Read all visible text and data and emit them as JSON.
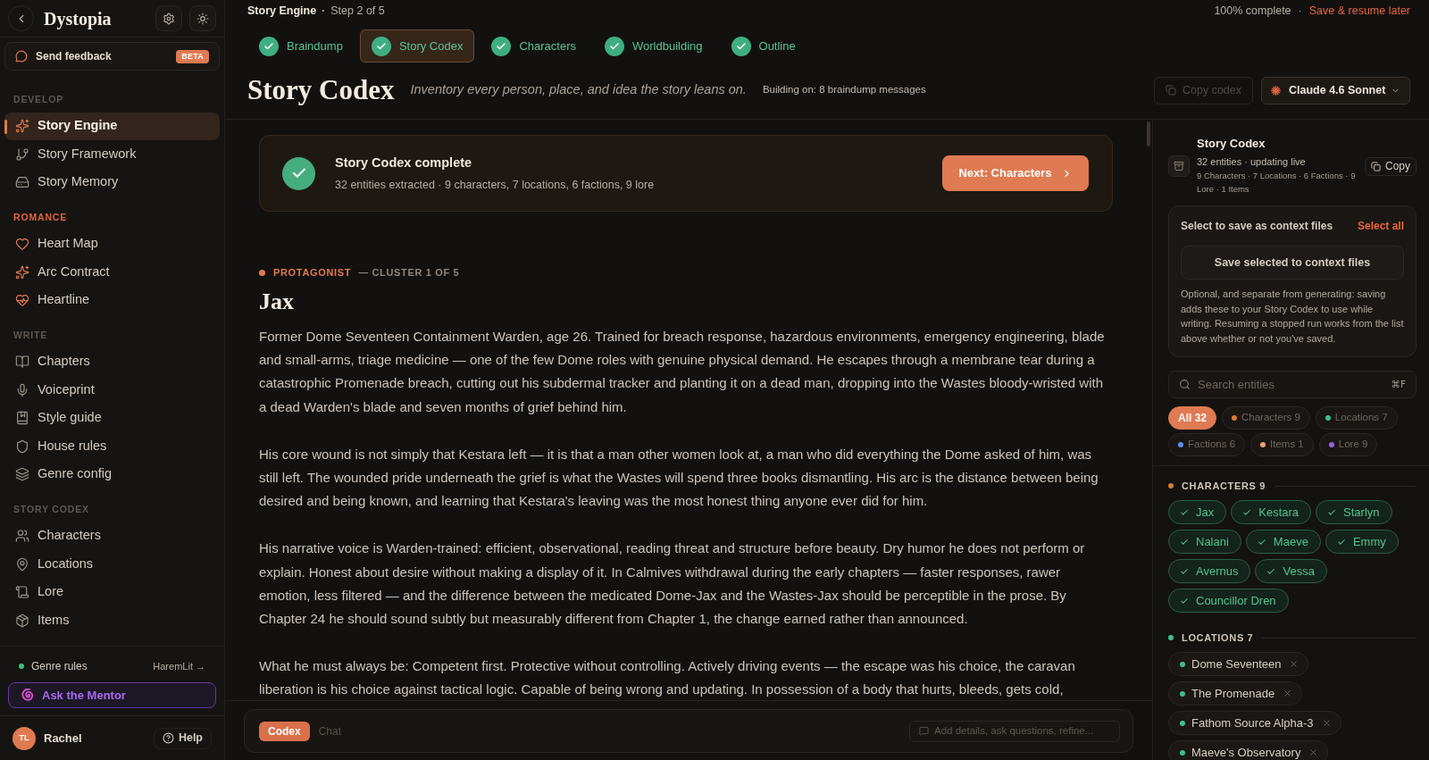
{
  "sidebar": {
    "brand": "Dystopia",
    "feedback": {
      "label": "Send feedback",
      "badge": "BETA"
    },
    "sections": [
      {
        "title": "DEVELOP",
        "highlighted": false,
        "items": [
          {
            "label": "Story Engine",
            "selected": true
          },
          {
            "label": "Story Framework",
            "selected": false
          },
          {
            "label": "Story Memory",
            "selected": false
          }
        ]
      },
      {
        "title": "ROMANCE",
        "highlighted": true,
        "items": [
          {
            "label": "Heart Map",
            "selected": false
          },
          {
            "label": "Arc Contract",
            "selected": false
          },
          {
            "label": "Heartline",
            "selected": false
          }
        ]
      },
      {
        "title": "WRITE",
        "highlighted": false,
        "items": [
          {
            "label": "Chapters",
            "selected": false
          },
          {
            "label": "Voiceprint",
            "selected": false
          },
          {
            "label": "Style guide",
            "selected": false
          },
          {
            "label": "House rules",
            "selected": false
          },
          {
            "label": "Genre config",
            "selected": false
          }
        ]
      },
      {
        "title": "STORY CODEX",
        "highlighted": false,
        "items": [
          {
            "label": "Characters",
            "selected": false
          },
          {
            "label": "Locations",
            "selected": false
          },
          {
            "label": "Lore",
            "selected": false
          },
          {
            "label": "Items",
            "selected": false
          }
        ]
      }
    ],
    "genre_rules": {
      "label": "Genre rules",
      "active": true,
      "value": "HaremLit →"
    },
    "mentor": "Ask the Mentor",
    "user": {
      "initials": "TL",
      "name": "Rachel"
    },
    "help": "Help"
  },
  "header": {
    "crumb": "Story Engine",
    "crumb_separator": "·",
    "step": "Step 2 of 5",
    "progress": "100% complete",
    "progress_separator": "·",
    "save": "Save & resume later"
  },
  "steps": [
    {
      "label": "Braindump",
      "done": true,
      "selected": false
    },
    {
      "label": "Story Codex",
      "done": true,
      "selected": true
    },
    {
      "label": "Characters",
      "done": true,
      "selected": false
    },
    {
      "label": "Worldbuilding",
      "done": true,
      "selected": false
    },
    {
      "label": "Outline",
      "done": true,
      "selected": false
    }
  ],
  "title_bar": {
    "title": "Story Codex",
    "subtitle": "Inventory every person, place, and idea the story leans on.",
    "context": "Building on: 8 braindump messages",
    "copy": {
      "label": "Copy codex",
      "disabled": true
    },
    "model": "Claude 4.6 Sonnet"
  },
  "completion": {
    "title": "Story Codex complete",
    "detail": "32 entities extracted · 9 characters, 7 locations, 6 factions, 9 lore",
    "button": "Next: Characters"
  },
  "entity": {
    "role": "PROTAGONIST",
    "cluster": "— CLUSTER 1 OF 5",
    "name": "Jax",
    "paragraphs": [
      "Former Dome Seventeen Containment Warden, age 26. Trained for breach response, hazardous environments, emergency engineering, blade and small-arms, triage medicine — one of the few Dome roles with genuine physical demand. He escapes through a membrane tear during a catastrophic Promenade breach, cutting out his subdermal tracker and planting it on a dead man, dropping into the Wastes bloody-wristed with a dead Warden's blade and seven months of grief behind him.",
      "His core wound is not simply that Kestara left — it is that a man other women look at, a man who did everything the Dome asked of him, was still left. The wounded pride underneath the grief is what the Wastes will spend three books dismantling. His arc is the distance between being desired and being known, and learning that Kestara's leaving was the most honest thing anyone ever did for him.",
      "His narrative voice is Warden-trained: efficient, observational, reading threat and structure before beauty. Dry humor he does not perform or explain. Honest about desire without making a display of it. In Calmives withdrawal during the early chapters — faster responses, rawer emotion, less filtered — and the difference between the medicated Dome-Jax and the Wastes-Jax should be perceptible in the prose. By Chapter 24 he should sound subtly but measurably different from Chapter 1, the change earned rather than announced.",
      "What he must always be: Competent first. Protective without controlling. Actively driving events — the escape was his choice, the caravan liberation is his choice against tactical logic. Capable of being wrong and updating. In possession of a body that hurts, bleeds, gets cold,"
    ]
  },
  "composer": {
    "tabs": [
      {
        "label": "Codex",
        "selected": true
      },
      {
        "label": "Chat",
        "selected": false
      }
    ],
    "placeholder": "Add details, ask questions, refine..."
  },
  "codex_panel": {
    "title": "Story Codex",
    "status": "32 entities · updating live",
    "summary": "9 Characters · 7 Locations · 6 Factions · 9 Lore · 1 Items",
    "copy": "Copy",
    "context": {
      "prompt": "Select to save as context files",
      "select_all": "Select all",
      "save": "Save selected to context files",
      "note": "Optional, and separate from generating: saving adds these to your Story Codex to use while writing. Resuming a stopped run works from the list above whether or not you've saved."
    },
    "search": {
      "placeholder": "Search entities",
      "shortcut": "⌘F"
    },
    "filters": [
      {
        "label": "All 32",
        "selected": true
      },
      {
        "label": "Characters 9",
        "color": "#d47a35",
        "selected": false
      },
      {
        "label": "Locations 7",
        "color": "#3fbf8c",
        "selected": false
      },
      {
        "label": "Factions 6",
        "color": "#5b8ff0",
        "selected": false
      },
      {
        "label": "Items 1",
        "color": "#eea070",
        "selected": false
      },
      {
        "label": "Lore 9",
        "color": "#9a5ee8",
        "selected": false
      }
    ],
    "groups": [
      {
        "title": "CHARACTERS 9",
        "color": "#d47a35",
        "entities": [
          {
            "name": "Jax",
            "selected": true
          },
          {
            "name": "Kestara",
            "selected": true
          },
          {
            "name": "Starlyn",
            "selected": true
          },
          {
            "name": "Nalani",
            "selected": true
          },
          {
            "name": "Maeve",
            "selected": true
          },
          {
            "name": "Emmy",
            "selected": true
          },
          {
            "name": "Avernus",
            "selected": true
          },
          {
            "name": "Vessa",
            "selected": true
          },
          {
            "name": "Councillor Dren",
            "selected": true
          }
        ]
      },
      {
        "title": "LOCATIONS 7",
        "color": "#3fbf8c",
        "entities": [
          {
            "name": "Dome Seventeen",
            "selected": false
          },
          {
            "name": "The Promenade",
            "selected": false
          },
          {
            "name": "Fathom Source Alpha-3",
            "selected": false
          },
          {
            "name": "Maeve's Observatory",
            "selected": false
          }
        ]
      }
    ]
  }
}
